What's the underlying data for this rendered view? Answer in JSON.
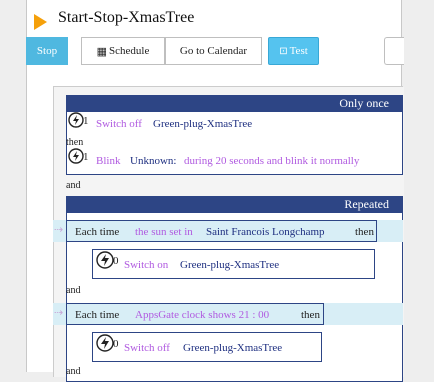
{
  "header": {
    "title": "Start-Stop-XmasTree"
  },
  "toolbar": {
    "stop": "Stop",
    "schedule": "Schedule",
    "calendar": "Go to Calendar",
    "test": "Test"
  },
  "rules": {
    "once_header": "Only once",
    "repeated_header": "Repeated",
    "connector_then": "then",
    "connector_and": "and",
    "once_action1": {
      "verb": "Switch off",
      "device": "Green-plug-XmasTree"
    },
    "once_action2": {
      "verb": "Blink",
      "device": "Unknown:",
      "detail": "during 20 seconds and blink it normally"
    },
    "rep1": {
      "each": "Each time",
      "cond": "the sun set in",
      "place": "Saint Francois Longchamp",
      "then": "then",
      "verb": "Switch on",
      "device": "Green-plug-XmasTree"
    },
    "rep2": {
      "each": "Each time",
      "cond": "AppsGate clock shows 21 : 00",
      "then": "then",
      "verb": "Switch off",
      "device": "Green-plug-XmasTree"
    },
    "trail_and": "and"
  }
}
